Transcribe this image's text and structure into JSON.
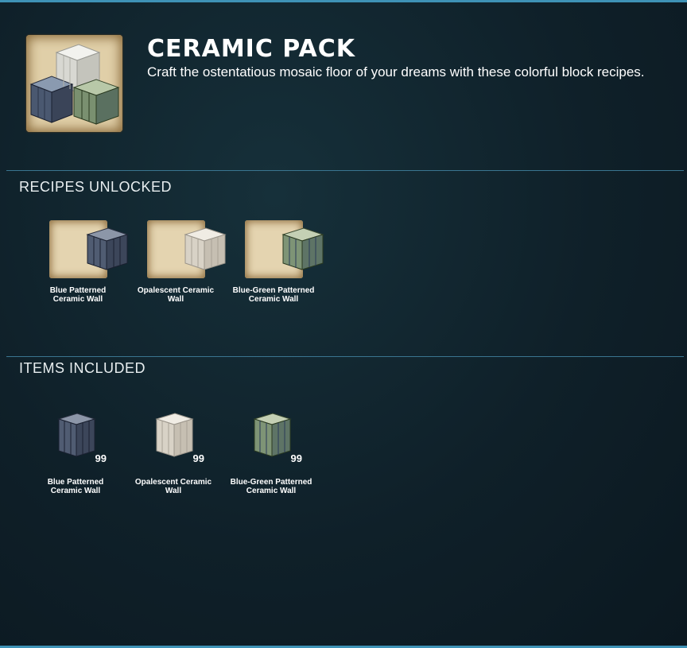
{
  "pack": {
    "title": "CERAMIC PACK",
    "description": "Craft the ostentatious mosaic floor of your dreams with these colorful block recipes.",
    "icon": "ceramic-blocks-icon"
  },
  "recipes_section": {
    "heading": "RECIPES UNLOCKED",
    "items": [
      {
        "label": "Blue Patterned Ceramic Wall",
        "icon": "blue-patterned-ceramic-wall-icon"
      },
      {
        "label": "Opalescent Ceramic Wall",
        "icon": "opalescent-ceramic-wall-icon"
      },
      {
        "label": "Blue-Green Patterned Ceramic Wall",
        "icon": "blue-green-patterned-ceramic-wall-icon"
      }
    ]
  },
  "items_section": {
    "heading": "ITEMS INCLUDED",
    "items": [
      {
        "label": "Blue Patterned Ceramic Wall",
        "quantity": "99",
        "icon": "blue-patterned-ceramic-wall-icon"
      },
      {
        "label": "Opalescent Ceramic Wall",
        "quantity": "99",
        "icon": "opalescent-ceramic-wall-icon"
      },
      {
        "label": "Blue-Green Patterned Ceramic Wall",
        "quantity": "99",
        "icon": "blue-green-patterned-ceramic-wall-icon"
      }
    ]
  },
  "colors": {
    "accent": "#3e92b6",
    "background": "#0f2029",
    "parchment": "#e0cfa8"
  }
}
